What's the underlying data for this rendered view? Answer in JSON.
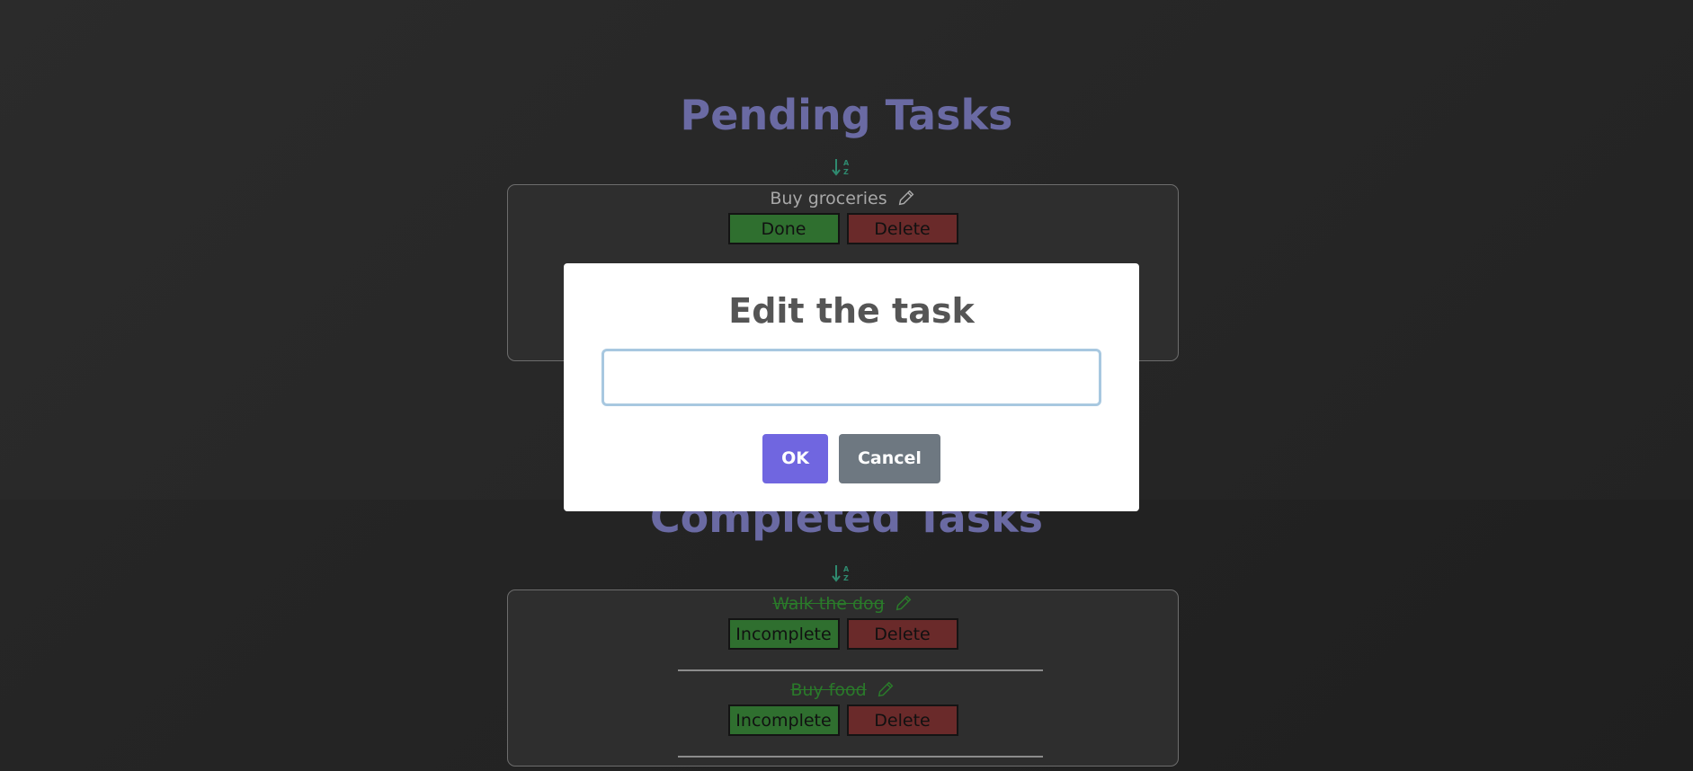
{
  "pending": {
    "title": "Pending Tasks",
    "sort_icon": "sort-alpha-down-icon",
    "tasks": [
      {
        "text": "Buy groceries",
        "done_label": "Done",
        "delete_label": "Delete"
      }
    ]
  },
  "completed": {
    "title": "Completed Tasks",
    "sort_icon": "sort-alpha-down-icon",
    "tasks": [
      {
        "text": "Walk the dog",
        "incomplete_label": "Incomplete",
        "delete_label": "Delete"
      },
      {
        "text": "Buy food",
        "incomplete_label": "Incomplete",
        "delete_label": "Delete"
      }
    ]
  },
  "modal": {
    "title": "Edit the task",
    "input_value": "",
    "ok_label": "OK",
    "cancel_label": "Cancel"
  },
  "colors": {
    "title": "#6a6aa3",
    "done_button": "#2f6f2f",
    "delete_button": "#6a2a2a",
    "completed_text": "#2a7a2a",
    "ok_button": "#7066e0",
    "cancel_button": "#6e7881"
  }
}
